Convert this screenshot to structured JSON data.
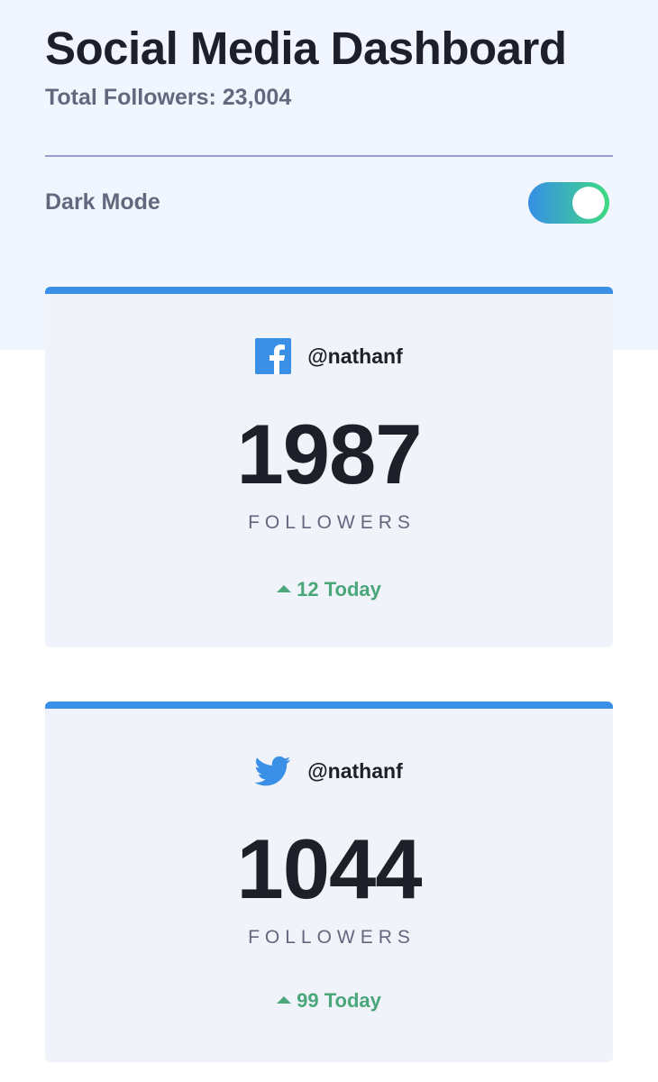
{
  "header": {
    "title": "Social Media Dashboard",
    "total_followers": "Total Followers: 23,004",
    "dark_mode_label": "Dark Mode",
    "dark_mode_on": true
  },
  "cards": [
    {
      "platform": "facebook",
      "icon": "facebook-icon",
      "handle": "@nathanf",
      "count": "1987",
      "label": "FOLLOWERS",
      "today": "12 Today",
      "accent": "#3a8fe6"
    },
    {
      "platform": "twitter",
      "icon": "twitter-icon",
      "handle": "@nathanf",
      "count": "1044",
      "label": "FOLLOWERS",
      "today": "99 Today",
      "accent": "#3a8fe6"
    }
  ],
  "colors": {
    "top_bg": "#f1f5fe",
    "card_bg": "#f0f3fa",
    "accent_blue": "#3a8fe6",
    "up_green": "#4aa77a",
    "text_dark": "#1d1f29",
    "text_muted": "#63687e"
  }
}
